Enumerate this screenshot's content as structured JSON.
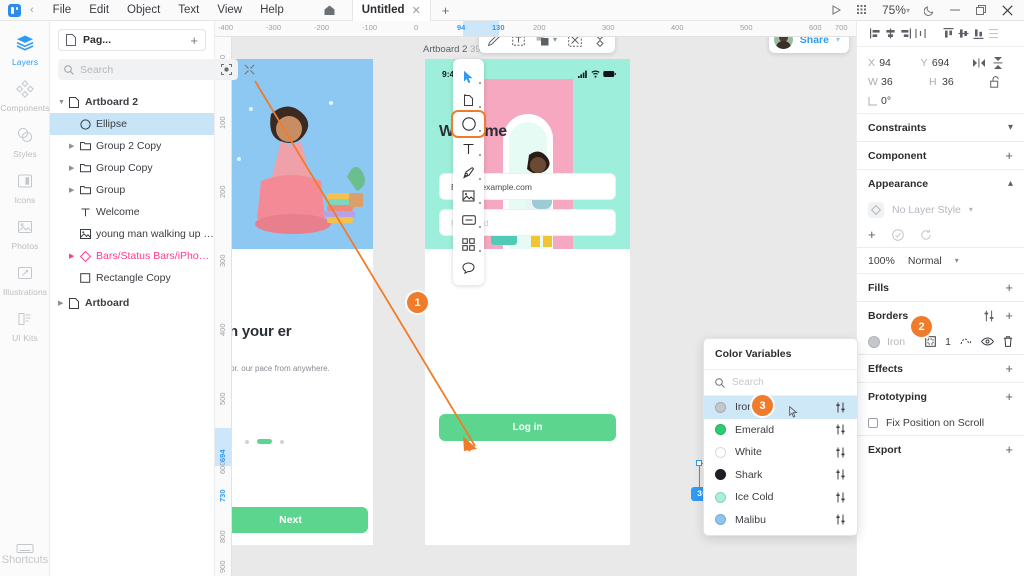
{
  "menubar": {
    "logo_icon": "app-logo-icon",
    "back_icon": "chevron-left-icon",
    "items": [
      "File",
      "Edit",
      "Object",
      "Text",
      "View",
      "Help"
    ],
    "home_icon": "home-icon",
    "tab_title": "Untitled",
    "tab_close_icon": "close-icon",
    "tab_add_icon": "plus-icon",
    "play_icon": "play-icon",
    "grid_icon": "grid-icon",
    "zoom_level": "75%",
    "zoom_caret_icon": "chevron-down-icon",
    "dark_mode_icon": "moon-icon",
    "minimize_icon": "minimize-icon",
    "maximize_icon": "maximize-icon",
    "close_window_icon": "close-icon"
  },
  "rail": {
    "items": [
      {
        "label": "Layers",
        "icon": "layers-icon",
        "active": true
      },
      {
        "label": "Components",
        "icon": "components-icon",
        "active": false
      },
      {
        "label": "Styles",
        "icon": "styles-icon",
        "active": false
      },
      {
        "label": "Icons",
        "icon": "icons-icon",
        "active": false
      },
      {
        "label": "Photos",
        "icon": "photos-icon",
        "active": false
      },
      {
        "label": "Illustrations",
        "icon": "illustrations-icon",
        "active": false
      },
      {
        "label": "UI Kits",
        "icon": "ui-kits-icon",
        "active": false
      }
    ],
    "shortcuts": {
      "label": "Shortcuts",
      "icon": "keyboard-icon"
    }
  },
  "layers_panel": {
    "page_icon": "page-icon",
    "page_name": "Pag...",
    "add_page_icon": "plus-icon",
    "search_icon": "search-icon",
    "search_placeholder": "Search",
    "search_value": "",
    "filter_icon": "focus-icon",
    "collapse_icon": "collapse-icon",
    "rows": [
      {
        "name": "Artboard 2",
        "icon": "artboard-icon",
        "indent": 0,
        "caret": true,
        "selected": false,
        "bold": true,
        "pink": false
      },
      {
        "name": "Ellipse",
        "icon": "ellipse-icon",
        "indent": 1,
        "caret": false,
        "selected": true,
        "bold": false,
        "pink": false
      },
      {
        "name": "Group 2 Copy",
        "icon": "folder-icon",
        "indent": 1,
        "caret": true,
        "selected": false,
        "bold": false,
        "pink": false
      },
      {
        "name": "Group Copy",
        "icon": "folder-icon",
        "indent": 1,
        "caret": true,
        "selected": false,
        "bold": false,
        "pink": false
      },
      {
        "name": "Group",
        "icon": "folder-icon",
        "indent": 1,
        "caret": true,
        "selected": false,
        "bold": false,
        "pink": false
      },
      {
        "name": "Welcome",
        "icon": "text-icon",
        "indent": 1,
        "caret": false,
        "selected": false,
        "bold": false,
        "pink": false
      },
      {
        "name": "young man walking up stairs",
        "icon": "image-icon",
        "indent": 1,
        "caret": false,
        "selected": false,
        "bold": false,
        "pink": false
      },
      {
        "name": "Bars/Status Bars/iPhone/Lig...",
        "icon": "symbol-icon",
        "indent": 1,
        "caret": true,
        "selected": false,
        "bold": false,
        "pink": true
      },
      {
        "name": "Rectangle Copy",
        "icon": "rectangle-icon",
        "indent": 1,
        "caret": false,
        "selected": false,
        "bold": false,
        "pink": false
      },
      {
        "name": "Artboard",
        "icon": "artboard-icon",
        "indent": 0,
        "caret": true,
        "selected": false,
        "bold": true,
        "pink": false
      }
    ]
  },
  "rulers": {
    "horizontal_ticks": [
      "-400",
      "-300",
      "-200",
      "-100",
      "0",
      "94",
      "130",
      "200",
      "300",
      "400",
      "500",
      "600",
      "700"
    ],
    "horizontal_highlight": [
      "94",
      "130"
    ],
    "vertical_ticks": [
      "0",
      "100",
      "200",
      "300",
      "400",
      "500",
      "600",
      "694",
      "730",
      "800",
      "900"
    ],
    "vertical_highlight": [
      "694",
      "730"
    ]
  },
  "tool_palette": {
    "tools": [
      {
        "icon": "cursor-arrow-icon",
        "selected": false
      },
      {
        "icon": "artboard-tool-icon",
        "selected": false
      },
      {
        "icon": "ellipse-tool-icon",
        "selected": true
      },
      {
        "icon": "text-tool-icon",
        "selected": false
      },
      {
        "icon": "pen-tool-icon",
        "selected": false
      },
      {
        "icon": "image-tool-icon",
        "selected": false
      },
      {
        "icon": "button-tool-icon",
        "selected": false
      },
      {
        "icon": "components-tool-icon",
        "selected": false
      },
      {
        "icon": "comment-tool-icon",
        "selected": false
      }
    ]
  },
  "float_toolbar": {
    "items": [
      {
        "icon": "pencil-edit-icon"
      },
      {
        "icon": "text-box-icon"
      },
      {
        "icon": "boolean-ops-icon"
      },
      {
        "icon": "boolean-caret-icon"
      },
      {
        "icon": "mask-icon"
      },
      {
        "icon": "flatten-icon"
      }
    ]
  },
  "share": {
    "avatar_icon": "avatar",
    "label": "Share",
    "caret_icon": "chevron-down-icon"
  },
  "canvas": {
    "artboard_2": {
      "label": "Artboard 2",
      "size": "390×844",
      "status_time": "9:41",
      "status_icons": [
        "cellular-icon",
        "wifi-icon",
        "battery-icon"
      ],
      "heading": "Welcome",
      "email_value": "Bates@example.com",
      "password_placeholder": "Password",
      "login_label": "Log in"
    },
    "artboard_1": {
      "heading": "step in your\ner",
      "body": "ght instructor.\nour pace from anywhere.",
      "next_label": "Next"
    },
    "selection_size": "36 x 36"
  },
  "color_popover": {
    "title": "Color Variables",
    "search_icon": "search-icon",
    "search_placeholder": "Search",
    "search_value": "",
    "rows": [
      {
        "name": "Iron",
        "color": "#c4c8cc",
        "selected": true,
        "adjust_icon": "sliders-icon"
      },
      {
        "name": "Emerald",
        "color": "#2ecc71",
        "selected": false,
        "adjust_icon": "sliders-icon"
      },
      {
        "name": "White",
        "color": "#ffffff",
        "selected": false,
        "adjust_icon": "sliders-icon"
      },
      {
        "name": "Shark",
        "color": "#1c2026",
        "selected": false,
        "adjust_icon": "sliders-icon"
      },
      {
        "name": "Ice Cold",
        "color": "#a8f0dc",
        "selected": false,
        "adjust_icon": "sliders-icon"
      },
      {
        "name": "Malibu",
        "color": "#8fc4f0",
        "selected": false,
        "adjust_icon": "sliders-icon"
      }
    ]
  },
  "inspector": {
    "align_icons": [
      "align-left-icon",
      "align-center-h-icon",
      "align-right-icon",
      "distribute-h-icon",
      "align-top-icon",
      "align-center-v-icon",
      "align-bottom-icon",
      "distribute-v-icon"
    ],
    "x_label": "X",
    "x_value": "94",
    "y_label": "Y",
    "y_value": "694",
    "w_label": "W",
    "w_value": "36",
    "h_label": "H",
    "h_value": "36",
    "rotation_label": "rotation",
    "rotation_value": "0°",
    "flip_h_icon": "flip-horizontal-icon",
    "flip_v_icon": "flip-vertical-icon",
    "lock_ratio_icon": "lock-open-icon",
    "sections": {
      "constraints": {
        "title": "Constraints",
        "action_icon": "chevron-down-icon"
      },
      "component": {
        "title": "Component",
        "action_icon": "plus-icon"
      },
      "appearance": {
        "title": "Appearance",
        "action_icon": "chevron-up-icon",
        "layer_style": "No Layer Style",
        "layer_style_caret": "chevron-down-icon",
        "add_icon": "plus-icon",
        "apply_icon": "check-circle-icon",
        "reset_icon": "reset-icon",
        "opacity": "100%",
        "blend_mode": "Normal",
        "blend_caret": "chevron-down-icon"
      },
      "fills": {
        "title": "Fills",
        "action_icon": "plus-icon"
      },
      "borders": {
        "title": "Borders",
        "settings_icon": "sliders-icon",
        "action_icon": "plus-icon",
        "color_name": "Iron",
        "color_hex": "#c4c8cc",
        "position_icon": "border-position-icon",
        "width": "1",
        "dash_icon": "dash-icon",
        "visibility_icon": "eye-icon",
        "delete_icon": "trash-icon"
      },
      "effects": {
        "title": "Effects",
        "action_icon": "plus-icon"
      },
      "prototyping": {
        "title": "Prototyping",
        "action_icon": "plus-icon",
        "fix_position_label": "Fix Position on Scroll",
        "fix_position_checked": false
      },
      "export": {
        "title": "Export",
        "action_icon": "plus-icon"
      }
    }
  },
  "annotations": [
    {
      "number": "1"
    },
    {
      "number": "2"
    },
    {
      "number": "3"
    }
  ],
  "colors": {
    "accent_blue": "#2f9bf2",
    "annotation_orange": "#f07c2b",
    "green": "#5cd68e",
    "pink_symbol": "#ff3b8e"
  }
}
